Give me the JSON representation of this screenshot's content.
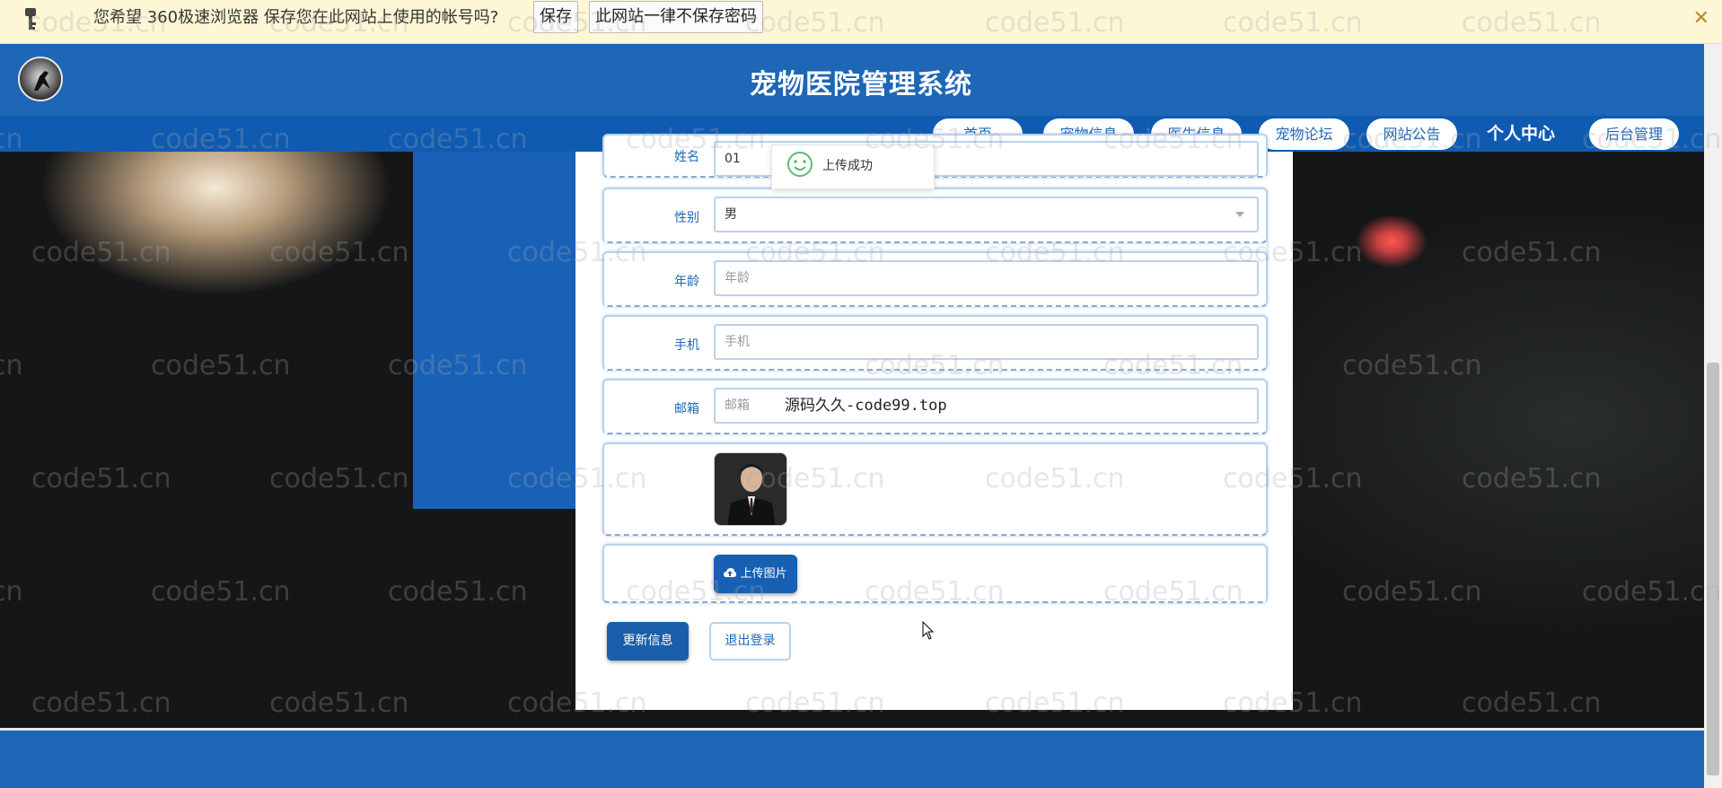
{
  "password_bar": {
    "message": "您希望 360极速浏览器 保存您在此网站上使用的帐号吗?",
    "save_label": "保存",
    "never_label": "此网站一律不保存密码",
    "close": "✕"
  },
  "header": {
    "title": "宠物医院管理系统"
  },
  "nav": [
    {
      "label": "首页"
    },
    {
      "label": "宠物信息"
    },
    {
      "label": "医生信息"
    },
    {
      "label": "宠物论坛"
    },
    {
      "label": "网站公告"
    },
    {
      "label": "个人中心"
    },
    {
      "label": "后台管理"
    }
  ],
  "toast": {
    "text": "上传成功"
  },
  "form": {
    "name": {
      "label": "姓名",
      "value": "01"
    },
    "gender": {
      "label": "性别",
      "value": "男"
    },
    "age": {
      "label": "年龄",
      "placeholder": "年龄"
    },
    "phone": {
      "label": "手机",
      "placeholder": "手机"
    },
    "email": {
      "label": "邮箱",
      "placeholder": "邮箱"
    },
    "upload_label": "上传图片",
    "update_label": "更新信息",
    "logout_label": "退出登录"
  },
  "overlay_text": "源码久久-code99.top",
  "watermark": "code51.cn"
}
